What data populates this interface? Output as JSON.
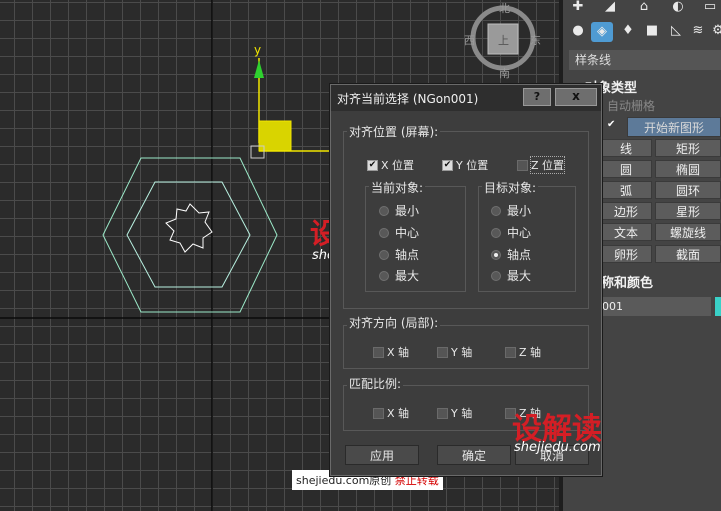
{
  "viewport": {
    "axis_y_label": "y",
    "viewcube": {
      "north": "北",
      "south": "南",
      "west": "西",
      "east": "东",
      "face": "上"
    }
  },
  "watermark": {
    "site": "shejiedu.com",
    "original": "原创",
    "forbidden": "禁止转载",
    "logo_text": "设解读",
    "logo_sub": "shejiedu.com"
  },
  "command_panel": {
    "dropdown_value": "样条线",
    "object_type_title": "对象类型",
    "autogrid_label": "自动栅格",
    "start_new_shape_label": "开始新图形",
    "buttons": [
      "线",
      "矩形",
      "圆",
      "椭圆",
      "弧",
      "圆环",
      "边形",
      "星形",
      "文本",
      "螺旋线",
      "卵形",
      "截面"
    ],
    "name_color_title": "称和颜色",
    "name_value": "001"
  },
  "dialog": {
    "title": "对齐当前选择 (NGon001)",
    "help_label": "?",
    "close_label": "x",
    "position_group": "对齐位置 (屏幕):",
    "x_position": "X 位置",
    "y_position": "Y 位置",
    "z_position": "Z 位置",
    "current_object_label": "当前对象:",
    "target_object_label": "目标对象:",
    "current_options": [
      "最小",
      "中心",
      "轴点",
      "最大"
    ],
    "target_options": [
      "最小",
      "中心",
      "轴点",
      "最大"
    ],
    "current_selected": "最小",
    "target_selected": "轴点",
    "orientation_group": "对齐方向 (局部):",
    "orient_x": "X 轴",
    "orient_y": "Y 轴",
    "orient_z": "Z 轴",
    "scale_group": "匹配比例:",
    "scale_x": "X 轴",
    "scale_y": "Y 轴",
    "scale_z": "Z 轴",
    "apply_label": "应用",
    "ok_label": "确定",
    "cancel_label": "取消"
  }
}
